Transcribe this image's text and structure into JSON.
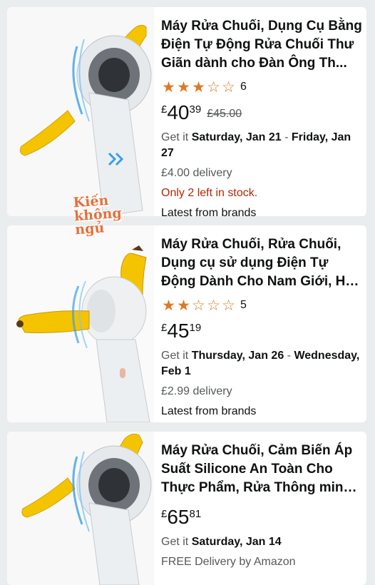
{
  "products": [
    {
      "title": "Máy Rửa Chuối, Dụng Cụ Bằng Điện Tự Động Rửa Chuối Thư Giãn dành cho Đàn Ông Th...",
      "rating": 3,
      "rating_count": "6",
      "price_currency": "£",
      "price_whole": "40",
      "price_fraction": "39",
      "old_price": "£45.00",
      "delivery_prefix": "Get it ",
      "delivery_date": "Saturday, Jan 21",
      "delivery_sep": " - ",
      "delivery_date2": "Friday, Jan 27",
      "delivery_fee": "£4.00 delivery",
      "stock": "Only 2 left in stock.",
      "brand_note": "Latest from brands"
    },
    {
      "title": "Máy Rửa Chuối, Rửa Chuối, Dụng cụ sử dụng Điện Tự Động Dành Cho Nam Giới, Hấp Dẫ...",
      "rating": 2,
      "rating_count": "5",
      "price_currency": "£",
      "price_whole": "45",
      "price_fraction": "19",
      "delivery_prefix": "Get it ",
      "delivery_date": "Thursday, Jan 26",
      "delivery_sep": " - ",
      "delivery_date2": "Wednesday, Feb 1",
      "delivery_fee": "£2.99 delivery",
      "brand_note": "Latest from brands"
    },
    {
      "title": "Máy Rửa Chuối, Cảm Biến Áp Suất Silicone An Toàn Cho Thực Phẩm, Rửa Thông minh, Trái c...",
      "price_currency": "£",
      "price_whole": "65",
      "price_fraction": "81",
      "delivery_prefix": "Get it ",
      "delivery_date": "Saturday, Jan 14",
      "delivery_fee": "FREE Delivery by Amazon"
    }
  ],
  "watermark": {
    "line1": "Kiến",
    "line2": "không",
    "line3": "ngủ"
  },
  "colors": {
    "star": "#de7921",
    "stock": "#b12704",
    "banana": "#f5c400",
    "ring": "#3aa0e6"
  }
}
